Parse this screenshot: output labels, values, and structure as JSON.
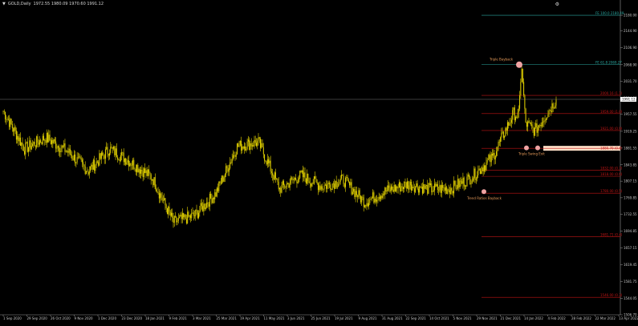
{
  "window": {
    "title": "GOLD,Daily",
    "ohlc": "1972.55 1980.09 1970.60 1991.12",
    "corner_icon": "settings-icon"
  },
  "colors": {
    "background": "#000000",
    "candle": "#e5d400",
    "red_level": "#c11515",
    "fib_extension": "#2aa7a0",
    "annotation_text": "#e79b5a",
    "marker": "#f0a3a3",
    "zone": "#ffe1c8",
    "axis_text": "#c7c7c7",
    "bid_line": "#7b7b7b"
  },
  "price_axis": {
    "ticks": [
      "2180.00",
      "2144.90",
      "2106.90",
      "2068.90",
      "2031.70",
      "1994.00",
      "1957.55",
      "1919.25",
      "1881.55",
      "1843.85",
      "1807.15",
      "1769.85",
      "1732.55",
      "1694.85",
      "1657.15",
      "1619.45",
      "1581.75",
      "1544.05",
      "1506.70"
    ],
    "current_price": "1991.12"
  },
  "time_axis": {
    "labels": [
      "1 Sep 2020",
      "29 Sep 2020",
      "26 Oct 2020",
      "9 Nov 2020",
      "1 Dec 2020",
      "23 Dec 2020",
      "18 Jan 2021",
      "9 Feb 2021",
      "3 Mar 2021",
      "25 Mar 2021",
      "19 Apr 2021",
      "11 May 2021",
      "3 Jun 2021",
      "25 Jun 2021",
      "19 Jul 2021",
      "9 Aug 2021",
      "31 Aug 2021",
      "22 Sep 2021",
      "14 Oct 2021",
      "5 Nov 2021",
      "29 Nov 2021",
      "21 Dec 2021",
      "14 Jan 2022",
      "4 Feb 2022",
      "28 Feb 2022",
      "22 Mar 2022",
      "13 Apr 2022"
    ]
  },
  "levels": [
    {
      "label": "FE 100.0 2180.49",
      "price": 2180,
      "style": "fib"
    },
    {
      "label": "FE 61.8 2069.27",
      "price": 2069,
      "style": "fib"
    },
    {
      "label": "2000.16 (1.1)",
      "price": 2000,
      "style": "red"
    },
    {
      "label": "1959.00 (1.0)",
      "price": 1959,
      "style": "red"
    },
    {
      "label": "1921.00 (0.9)",
      "price": 1921,
      "style": "red"
    },
    {
      "label": "1880.70 (0.8)",
      "price": 1881,
      "style": "zone"
    },
    {
      "label": "1832.00 (0.7)",
      "price": 1832,
      "style": "red"
    },
    {
      "label": "1818.00 (0.6)",
      "price": 1818,
      "style": "red"
    },
    {
      "label": "1780.00 (0.5)",
      "price": 1780,
      "style": "red"
    },
    {
      "label": "1681.71 (0.4)",
      "price": 1682,
      "style": "red"
    },
    {
      "label": "1546.00 (0.3)",
      "price": 1546,
      "style": "red"
    }
  ],
  "annotations": {
    "top": "Triple Bayback",
    "mid": "Triple Swing Exit",
    "bottom": "Trend Ratios Bayback"
  },
  "chart_data": {
    "type": "line",
    "title": "GOLD,Daily",
    "xlabel": "",
    "ylabel": "",
    "ylim": [
      1506.7,
      2200
    ],
    "x": [
      "1 Sep 2020",
      "29 Sep 2020",
      "26 Oct 2020",
      "9 Nov 2020",
      "1 Dec 2020",
      "23 Dec 2020",
      "18 Jan 2021",
      "9 Feb 2021",
      "3 Mar 2021",
      "25 Mar 2021",
      "19 Apr 2021",
      "11 May 2021",
      "3 Jun 2021",
      "25 Jun 2021",
      "19 Jul 2021",
      "9 Aug 2021",
      "31 Aug 2021",
      "22 Sep 2021",
      "14 Oct 2021",
      "5 Nov 2021",
      "29 Nov 2021",
      "21 Dec 2021",
      "14 Jan 2022",
      "4 Feb 2022",
      "28 Feb 2022",
      "22 Mar 2022",
      "13 Apr 2022"
    ],
    "series": [
      {
        "values": [
          1965,
          1880,
          1905,
          1875,
          1830,
          1880,
          1850,
          1815,
          1715,
          1730,
          1780,
          1885,
          1895,
          1790,
          1820,
          1795,
          1810,
          1760,
          1785,
          1800,
          1790,
          1790,
          1815,
          1860,
          1960,
          1920,
          1990
        ]
      }
    ]
  }
}
